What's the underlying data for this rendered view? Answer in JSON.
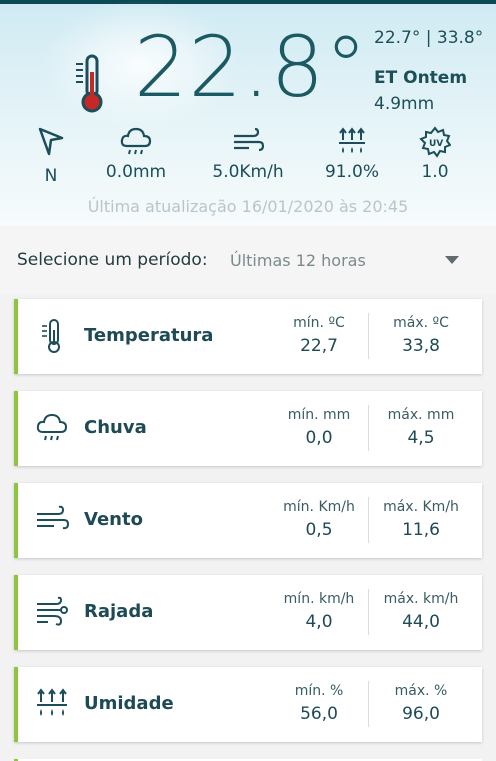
{
  "current": {
    "temperature": "22.8°",
    "min_max": "22.7° | 33.8°",
    "et_label": "ET Ontem",
    "et_value": "4.9mm"
  },
  "stats": [
    {
      "icon": "wind-direction-icon",
      "value": "N"
    },
    {
      "icon": "rain-cloud-icon",
      "value": "0.0mm"
    },
    {
      "icon": "wind-icon",
      "value": "5.0Km/h"
    },
    {
      "icon": "humidity-icon",
      "value": "91.0%"
    },
    {
      "icon": "uv-icon",
      "value": "1.0"
    }
  ],
  "last_update": "Última atualização 16/01/2020 às 20:45",
  "period": {
    "label": "Selecione um período:",
    "selected": "Últimas 12 horas"
  },
  "cards": [
    {
      "icon": "thermometer-icon",
      "title": "Temperatura",
      "min_label": "mín. ºC",
      "min": "22,7",
      "max_label": "máx. ºC",
      "max": "33,8"
    },
    {
      "icon": "rain-cloud-icon",
      "title": "Chuva",
      "min_label": "mín. mm",
      "min": "0,0",
      "max_label": "máx. mm",
      "max": "4,5"
    },
    {
      "icon": "wind-icon",
      "title": "Vento",
      "min_label": "mín. Km/h",
      "min": "0,5",
      "max_label": "máx. Km/h",
      "max": "11,6"
    },
    {
      "icon": "gust-icon",
      "title": "Rajada",
      "min_label": "mín. km/h",
      "min": "4,0",
      "max_label": "máx. km/h",
      "max": "44,0"
    },
    {
      "icon": "humidity-icon",
      "title": "Umidade",
      "min_label": "mín. %",
      "min": "56,0",
      "max_label": "máx. %",
      "max": "96,0"
    }
  ],
  "colors": {
    "primary": "#1b4e5a",
    "accent_green": "#8cc63f",
    "header_bg": "#cfeaf3"
  }
}
